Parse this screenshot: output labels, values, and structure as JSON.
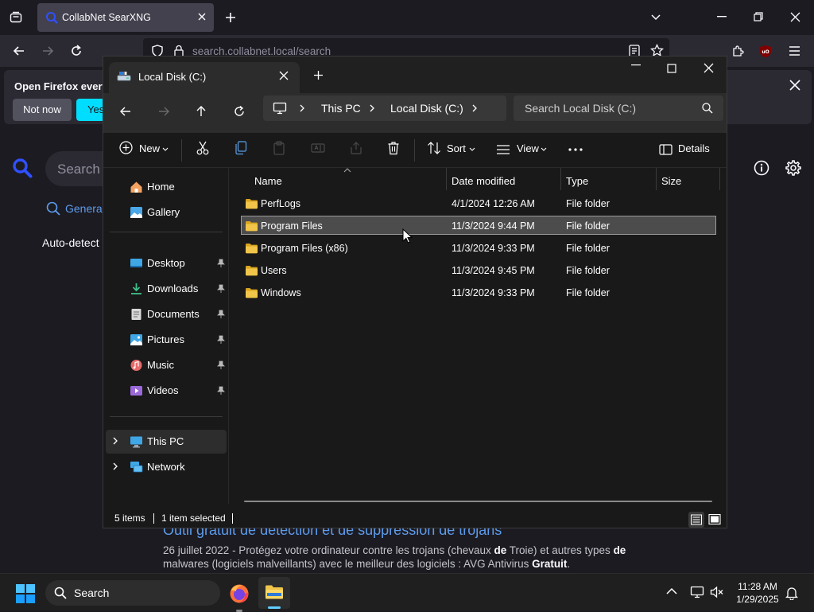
{
  "firefox": {
    "tab_title": "CollabNet SearXNG",
    "url_host": "search.collabnet.local",
    "url_path": "/search",
    "notice_text": "Open Firefox every",
    "notice_notnow": "Not now",
    "notice_yes": "Yes,"
  },
  "searxng": {
    "search_placeholder": "Search t",
    "tab_general": "General",
    "autodetect": "Auto-detect (",
    "result_title": "Outil gratuit de détection et de suppression de trojans",
    "result_desc_date": "26 juillet 2022 - Protégez votre ordinateur contre les trojans (chevaux ",
    "result_desc_b1": "de",
    "result_desc_p2": " Troie) et autres types ",
    "result_desc_b2": "de",
    "result_desc_p3": " malwares (logiciels malveillants) avec le meilleur des logiciels : AVG Antivirus ",
    "result_desc_b3": "Gratuit",
    "result_desc_p4": "."
  },
  "explorer": {
    "tab_title": "Local Disk (C:)",
    "breadcrumb": [
      "This PC",
      "Local Disk (C:)"
    ],
    "search_placeholder": "Search Local Disk (C:)",
    "commands": {
      "new": "New",
      "sort": "Sort",
      "view": "View",
      "details": "Details"
    },
    "sidebar": {
      "top": [
        {
          "label": "Home",
          "icon": "home-icon"
        },
        {
          "label": "Gallery",
          "icon": "gallery-icon"
        }
      ],
      "pinned": [
        {
          "label": "Desktop",
          "icon": "desktop-icon"
        },
        {
          "label": "Downloads",
          "icon": "downloads-icon"
        },
        {
          "label": "Documents",
          "icon": "documents-icon"
        },
        {
          "label": "Pictures",
          "icon": "pictures-icon"
        },
        {
          "label": "Music",
          "icon": "music-icon"
        },
        {
          "label": "Videos",
          "icon": "videos-icon"
        }
      ],
      "bottom": [
        {
          "label": "This PC",
          "icon": "this-pc-icon"
        },
        {
          "label": "Network",
          "icon": "network-icon"
        }
      ]
    },
    "columns": [
      "Name",
      "Date modified",
      "Type",
      "Size"
    ],
    "rows": [
      {
        "name": "PerfLogs",
        "date": "4/1/2024 12:26 AM",
        "type": "File folder",
        "size": ""
      },
      {
        "name": "Program Files",
        "date": "11/3/2024 9:44 PM",
        "type": "File folder",
        "size": ""
      },
      {
        "name": "Program Files (x86)",
        "date": "11/3/2024 9:33 PM",
        "type": "File folder",
        "size": ""
      },
      {
        "name": "Users",
        "date": "11/3/2024 9:45 PM",
        "type": "File folder",
        "size": ""
      },
      {
        "name": "Windows",
        "date": "11/3/2024 9:33 PM",
        "type": "File folder",
        "size": ""
      }
    ],
    "selected_row": 1,
    "status": {
      "items": "5 items",
      "selected": "1 item selected"
    }
  },
  "taskbar": {
    "search_label": "Search",
    "time": "11:28 AM",
    "date": "1/29/2025"
  },
  "colors": {
    "folder_yellow": "#f0c54a",
    "selection": "#4c4c4c",
    "accent_blue": "#60cdff",
    "link_blue": "#5d9cec"
  }
}
